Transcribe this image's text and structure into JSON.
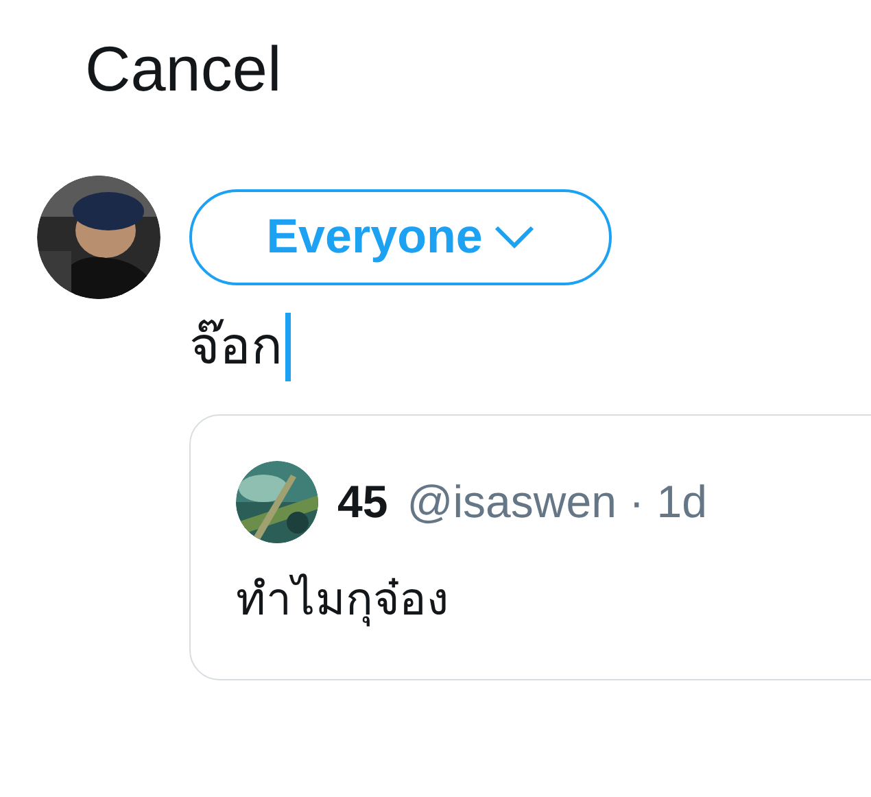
{
  "cancel": "Cancel",
  "audience": {
    "label": "Everyone"
  },
  "draft": {
    "value": "จ๊อก"
  },
  "quoted_tweet": {
    "name": "45",
    "handle": "@isaswen",
    "separator": "·",
    "time": "1d",
    "text": "ทำไมกุจ๋อง"
  }
}
